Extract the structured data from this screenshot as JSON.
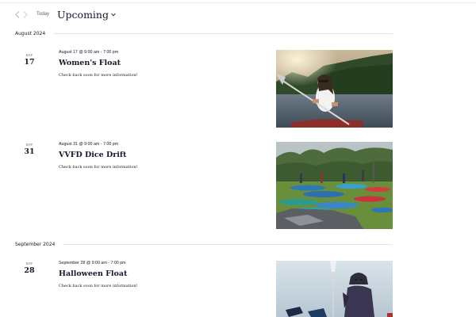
{
  "toolbar": {
    "today_label": "Today",
    "view_label": "Upcoming"
  },
  "months": [
    {
      "label": "August 2024"
    },
    {
      "label": "September 2024"
    }
  ],
  "events": [
    {
      "dow": "SAT",
      "day": "17",
      "time": "August 17 @ 9:00 am - 7:00 pm",
      "title": "Women's Float",
      "description": "Check back soon for more information!"
    },
    {
      "dow": "SAT",
      "day": "31",
      "time": "August 31 @ 9:00 am - 7:00 pm",
      "title": "VVFD Dice Drift",
      "description": "Check back soon for more information!"
    },
    {
      "dow": "SAT",
      "day": "28",
      "time": "September 28 @ 9:00 am - 7:00 pm",
      "title": "Halloween Float",
      "description": "Check back soon for more information!"
    }
  ]
}
